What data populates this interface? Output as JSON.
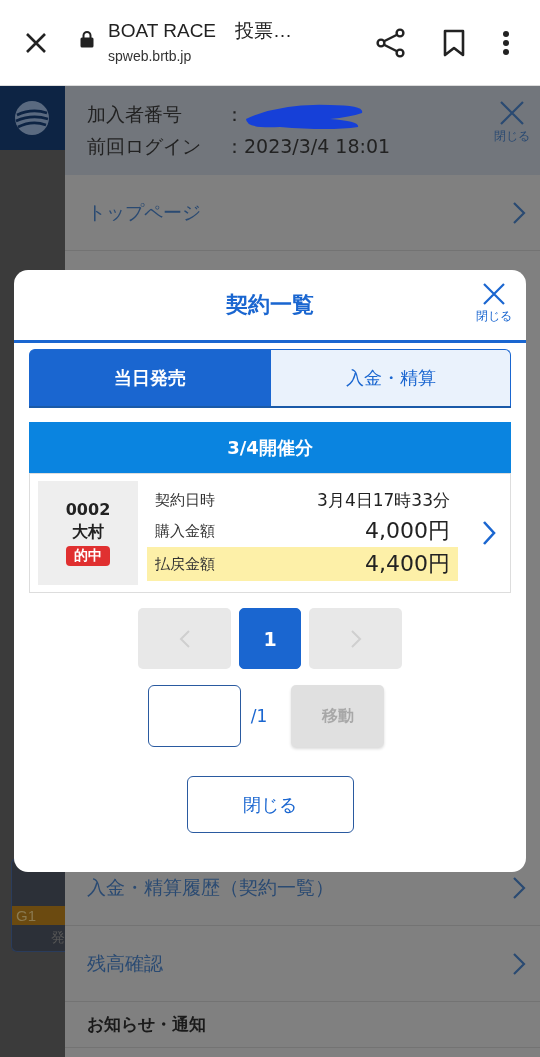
{
  "browser": {
    "title": "BOAT RACE　投票…",
    "url": "spweb.brtb.jp"
  },
  "background": {
    "grade": "G1",
    "caption": "発"
  },
  "menu": {
    "member_label": "加入者番号",
    "member_colon": "：",
    "login_label": "前回ログイン",
    "login_value": "：2023/3/4 18:01",
    "close_label": "閉じる",
    "items_top": [
      {
        "label": "トップページ"
      }
    ],
    "items_bottom": [
      {
        "label": "入金・精算履歴（契約一覧）"
      },
      {
        "label": "残高確認"
      }
    ],
    "section": "お知らせ・通知"
  },
  "modal": {
    "title": "契約一覧",
    "close_label": "閉じる",
    "tabs": [
      {
        "label": "当日発売",
        "selected": true
      },
      {
        "label": "入金・精算",
        "selected": false
      }
    ],
    "day_header": "3/4開催分",
    "contracts": [
      {
        "number": "0002",
        "venue": "大村",
        "result": "的中",
        "rows": [
          {
            "kind": "date",
            "label": "契約日時",
            "value": "3月4日17時33分"
          },
          {
            "kind": "amount",
            "label": "購入金額",
            "value": "4,000円"
          },
          {
            "kind": "payout",
            "label": "払戻金額",
            "value": "4,400円"
          }
        ]
      }
    ],
    "pagination": {
      "prev_disabled": true,
      "next_disabled": true,
      "pages": [
        {
          "label": "1",
          "selected": true
        }
      ]
    },
    "jump": {
      "total": "/1",
      "button": "移動",
      "disabled": true
    },
    "close_button": "閉じる"
  }
}
